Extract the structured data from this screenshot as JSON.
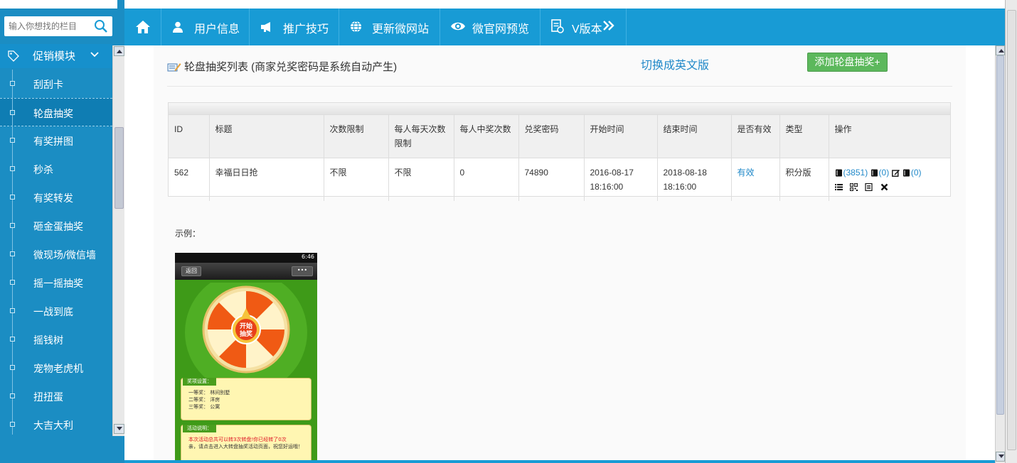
{
  "search": {
    "placeholder": "输入你想找的栏目"
  },
  "sidebar": {
    "section_title": "促销模块",
    "items": [
      {
        "label": "刮刮卡"
      },
      {
        "label": "轮盘抽奖"
      },
      {
        "label": "有奖拼图"
      },
      {
        "label": "秒杀"
      },
      {
        "label": "有奖转发"
      },
      {
        "label": "砸金蛋抽奖"
      },
      {
        "label": "微现场/微信墙"
      },
      {
        "label": "摇一摇抽奖"
      },
      {
        "label": "一战到底"
      },
      {
        "label": "摇钱树"
      },
      {
        "label": "宠物老虎机"
      },
      {
        "label": "扭扭蛋"
      },
      {
        "label": "大吉大利"
      }
    ]
  },
  "topnav": {
    "items": [
      {
        "label": "用户信息"
      },
      {
        "label": "推广技巧"
      },
      {
        "label": "更新微网站"
      },
      {
        "label": "微官网预览"
      },
      {
        "label": "V版本"
      }
    ]
  },
  "page": {
    "title": "轮盘抽奖列表 (商家兑奖密码是系统自动产生)",
    "switch_lang": "切换成英文版",
    "add_button": "添加轮盘抽奖+"
  },
  "table": {
    "headers": [
      "ID",
      "标题",
      "次数限制",
      "每人每天次数限制",
      "每人中奖次数",
      "兑奖密码",
      "开始时间",
      "结束时间",
      "是否有效",
      "类型",
      "操作"
    ],
    "rows": [
      {
        "id": "562",
        "title": "幸福日日抢",
        "times_limit": "不限",
        "daily_limit": "不限",
        "win_limit": "0",
        "password": "74890",
        "start_date": "2016-08-17",
        "start_time": "18:16:00",
        "end_date": "2018-08-18",
        "end_time": "18:16:00",
        "valid": "有效",
        "type": "积分版",
        "op_count_1": "(3851)",
        "op_count_2": "(0)",
        "op_count_3": "(0)"
      }
    ]
  },
  "example": {
    "label": "示例：",
    "phone": {
      "time": "6:46",
      "back": "返回",
      "more": "•••",
      "wheel_center": "开始\n抽奖",
      "prize_header": "奖项设置：",
      "prizes": [
        "一等奖： 林间别墅",
        "二等奖： 洋房",
        "三等奖： 公寓"
      ],
      "activity_header": "活动说明：",
      "activity_notice": "本次活动总共可以转3次转盘!你已经转了0次",
      "activity_text": "亲，请点击进入大转盘抽奖活动页面，祝您好运哦！"
    }
  },
  "colors": {
    "sidebar": "#1b8dc3",
    "topbar": "#189bd5",
    "accent_link": "#2189c9",
    "add_button": "#5cb85c"
  }
}
